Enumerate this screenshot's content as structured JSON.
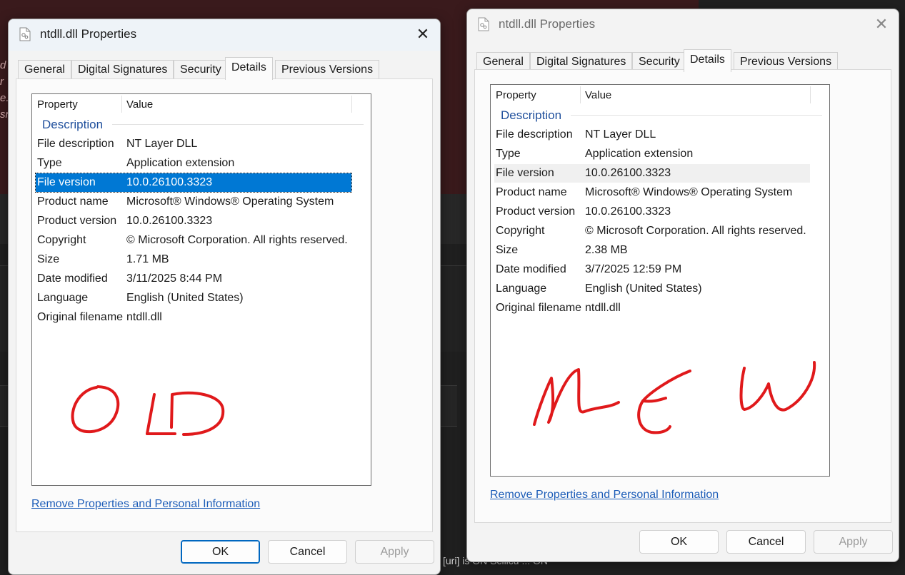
{
  "background": {
    "edge_letters": [
      "d",
      "r",
      "e.",
      "sn"
    ],
    "status_text": "[uri] is ON  Scilicu ... ON"
  },
  "dialogs": [
    {
      "id": "old",
      "title": "ntdll.dll Properties",
      "tabs": [
        "General",
        "Digital Signatures",
        "Security",
        "Details",
        "Previous Versions"
      ],
      "active_tab": "Details",
      "columns": [
        "Property",
        "Value"
      ],
      "group": "Description",
      "rows": [
        {
          "k": "File description",
          "v": "NT Layer DLL"
        },
        {
          "k": "Type",
          "v": "Application extension"
        },
        {
          "k": "File version",
          "v": "10.0.26100.3323"
        },
        {
          "k": "Product name",
          "v": "Microsoft® Windows® Operating System"
        },
        {
          "k": "Product version",
          "v": "10.0.26100.3323"
        },
        {
          "k": "Copyright",
          "v": "© Microsoft Corporation. All rights reserved."
        },
        {
          "k": "Size",
          "v": "1.71 MB"
        },
        {
          "k": "Date modified",
          "v": "3/11/2025 8:44 PM"
        },
        {
          "k": "Language",
          "v": "English (United States)"
        },
        {
          "k": "Original filename",
          "v": "ntdll.dll"
        }
      ],
      "selected_row": "File version",
      "annotation": "OLD",
      "annotation_color": "#e0191b",
      "link": "Remove Properties and Personal Information",
      "buttons": {
        "ok": "OK",
        "cancel": "Cancel",
        "apply": "Apply"
      }
    },
    {
      "id": "new",
      "title": "ntdll.dll Properties",
      "tabs": [
        "General",
        "Digital Signatures",
        "Security",
        "Details",
        "Previous Versions"
      ],
      "active_tab": "Details",
      "columns": [
        "Property",
        "Value"
      ],
      "group": "Description",
      "rows": [
        {
          "k": "File description",
          "v": "NT Layer DLL"
        },
        {
          "k": "Type",
          "v": "Application extension"
        },
        {
          "k": "File version",
          "v": "10.0.26100.3323"
        },
        {
          "k": "Product name",
          "v": "Microsoft® Windows® Operating System"
        },
        {
          "k": "Product version",
          "v": "10.0.26100.3323"
        },
        {
          "k": "Copyright",
          "v": "© Microsoft Corporation. All rights reserved."
        },
        {
          "k": "Size",
          "v": "2.38 MB"
        },
        {
          "k": "Date modified",
          "v": "3/7/2025 12:59 PM"
        },
        {
          "k": "Language",
          "v": "English (United States)"
        },
        {
          "k": "Original filename",
          "v": "ntdll.dll"
        }
      ],
      "selected_row": "File version",
      "annotation": "NEW",
      "annotation_color": "#e0191b",
      "link": "Remove Properties and Personal Information",
      "buttons": {
        "ok": "OK",
        "cancel": "Cancel",
        "apply": "Apply"
      }
    }
  ],
  "colors": {
    "selection_active": "#0078d4",
    "selection_inactive": "#f0f0f0",
    "link": "#1d5db8",
    "group_heading": "#1f4f9c"
  }
}
